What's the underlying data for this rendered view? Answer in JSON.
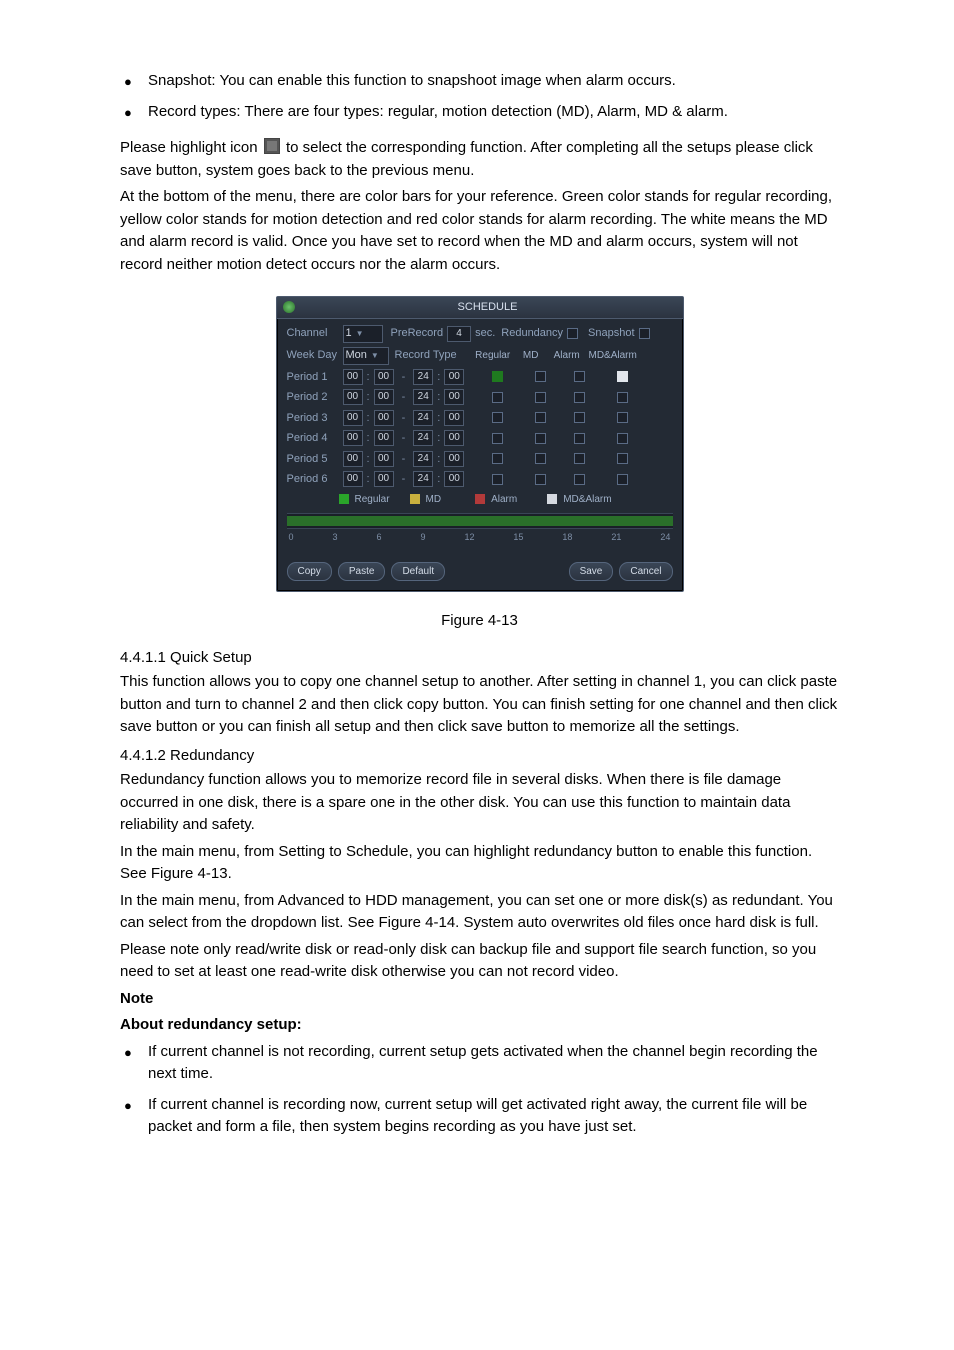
{
  "bullets_top": [
    "Snapshot: You can enable this function to snapshoot image when alarm occurs.",
    "Record types: There are four types: regular, motion detection (MD), Alarm, MD & alarm."
  ],
  "para_icon_before": "Please highlight icon ",
  "para_icon_after": " to select the corresponding function. After completing all the setups please click save button, system goes back to the previous menu.",
  "para_colorbars": "At the bottom of the menu, there are color bars for your reference. Green color stands for regular recording, yellow color stands for motion detection and red color stands for alarm recording. The white means the MD and alarm record is valid. Once you have set to record when the MD and alarm occurs, system will not record neither motion detect occurs nor the alarm occurs.",
  "figure_caption": "Figure 4-13",
  "sec1_title": "4.4.1.1  Quick Setup",
  "sec1_body": "This function allows you to copy one channel setup to another. After setting in channel 1, you can click paste button and turn to channel 2 and then click copy button. You can finish setting for one channel and then click save button or you can finish all setup and then click save button to memorize all the settings.",
  "sec2_title": "4.4.1.2  Redundancy",
  "sec2_p1": "Redundancy function allows you to memorize record file in several disks. When there is file damage occurred in one disk, there is a spare one in the other disk. You can use this function to maintain data reliability and safety.",
  "sec2_p2": "In the main menu, from Setting to Schedule, you can highlight redundancy button to enable this function. See Figure 4-13.",
  "sec2_p3": "In the main menu, from Advanced to HDD management, you can set one or more disk(s) as redundant. You can select from the dropdown list. See Figure 4-14. System auto overwrites old files once hard disk is full.",
  "sec2_p4": "Please note only read/write disk or read-only disk can backup file and support file search function, so you need to set at least one read-write disk otherwise you can not record video.",
  "note_label": "Note",
  "about_label": "About redundancy setup:",
  "bullets_bottom": [
    "If current channel is not recording, current setup gets activated when the channel begin recording the next time.",
    "If current channel is recording now, current setup will get activated right away, the current file will be packet and form a file, then system begins recording as you have just set."
  ],
  "dlg": {
    "title": "SCHEDULE",
    "labels": {
      "channel": "Channel",
      "prerecord": "PreRecord",
      "sec": "sec.",
      "redundancy": "Redundancy",
      "snapshot": "Snapshot",
      "weekday": "Week Day",
      "recordtype": "Record Type",
      "regular": "Regular",
      "md": "MD",
      "alarm": "Alarm",
      "mdalarm": "MD&Alarm"
    },
    "channel_value": "1",
    "prerecord_value": "4",
    "weekday_value": "Mon",
    "periods": [
      {
        "label": "Period 1",
        "h1": "00",
        "m1": "00",
        "h2": "24",
        "m2": "00",
        "r": true,
        "m": false,
        "a": false,
        "x": true
      },
      {
        "label": "Period 2",
        "h1": "00",
        "m1": "00",
        "h2": "24",
        "m2": "00",
        "r": false,
        "m": false,
        "a": false,
        "x": false
      },
      {
        "label": "Period 3",
        "h1": "00",
        "m1": "00",
        "h2": "24",
        "m2": "00",
        "r": false,
        "m": false,
        "a": false,
        "x": false
      },
      {
        "label": "Period 4",
        "h1": "00",
        "m1": "00",
        "h2": "24",
        "m2": "00",
        "r": false,
        "m": false,
        "a": false,
        "x": false
      },
      {
        "label": "Period 5",
        "h1": "00",
        "m1": "00",
        "h2": "24",
        "m2": "00",
        "r": false,
        "m": false,
        "a": false,
        "x": false
      },
      {
        "label": "Period 6",
        "h1": "00",
        "m1": "00",
        "h2": "24",
        "m2": "00",
        "r": false,
        "m": false,
        "a": false,
        "x": false
      }
    ],
    "legend": {
      "regular": "Regular",
      "md": "MD",
      "alarm": "Alarm",
      "mdalarm": "MD&Alarm"
    },
    "ticks": [
      "0",
      "3",
      "6",
      "9",
      "12",
      "15",
      "18",
      "21",
      "24"
    ],
    "buttons": {
      "copy": "Copy",
      "paste": "Paste",
      "default": "Default",
      "save": "Save",
      "cancel": "Cancel"
    }
  }
}
